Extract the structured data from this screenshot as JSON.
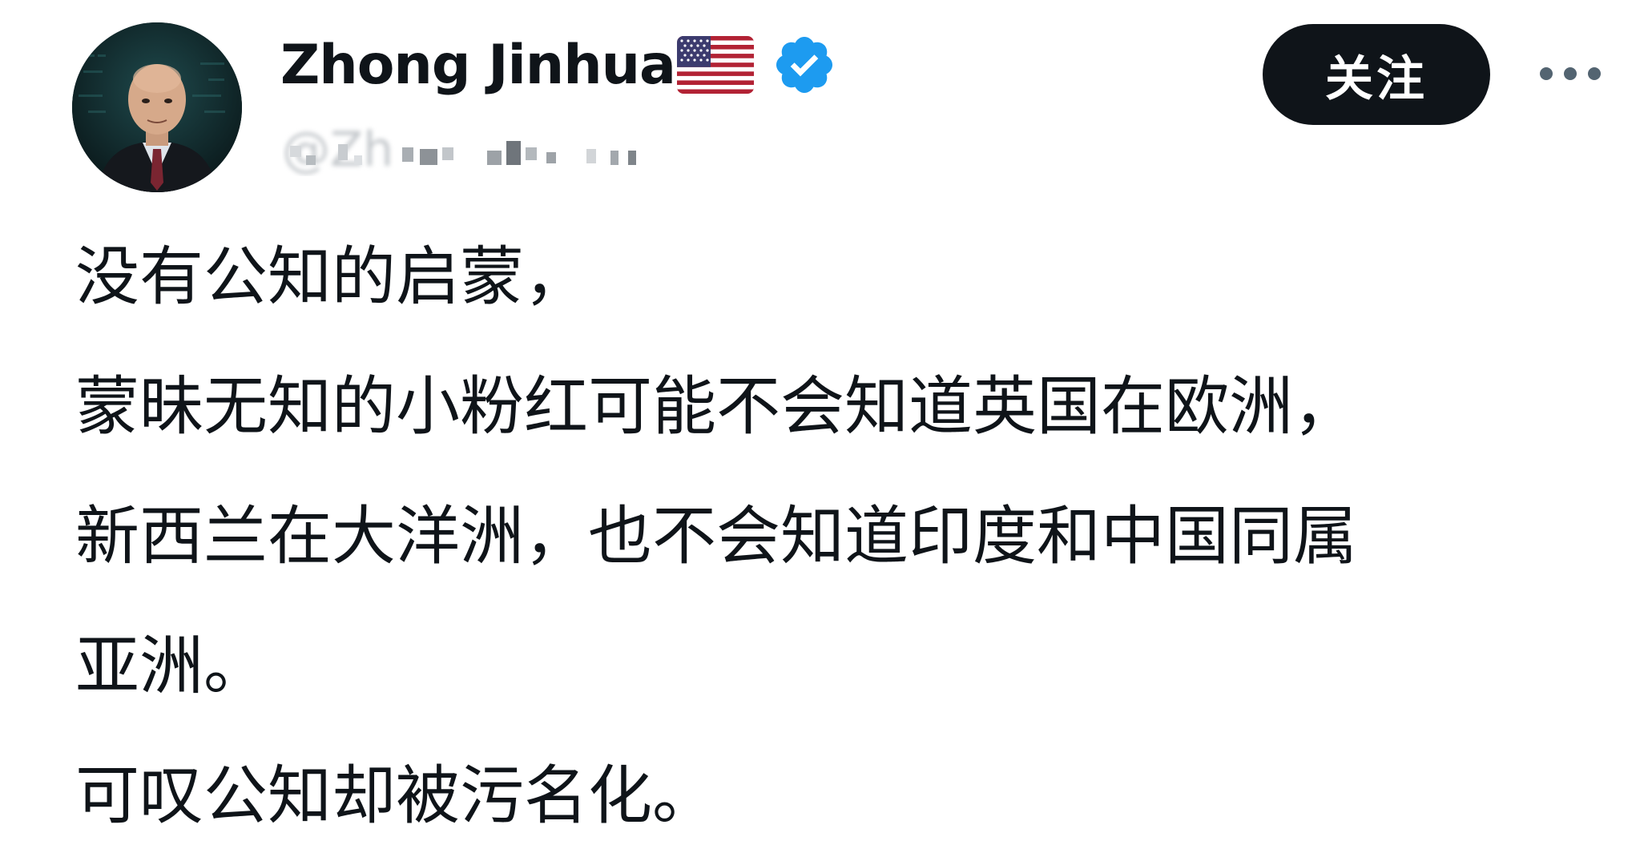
{
  "author": {
    "display_name": "Zhong Jinhua",
    "handle": "@Zh",
    "flag_icon": "us-flag-icon",
    "verified_icon": "verified-badge-icon",
    "verified_color": "#1d9bf0",
    "avatar_icon": "profile-avatar"
  },
  "actions": {
    "follow_label": "关注",
    "more_icon": "more-options-icon"
  },
  "tweet": {
    "lines": [
      "没有公知的启蒙，",
      "蒙昧无知的小粉红可能不会知道英国在欧洲，",
      "新西兰在大洋洲，也不会知道印度和中国同属",
      "亚洲。",
      "可叹公知却被污名化。"
    ]
  },
  "colors": {
    "text": "#0f1419",
    "button_bg": "#0f1419",
    "button_text": "#ffffff",
    "background": "#ffffff"
  }
}
